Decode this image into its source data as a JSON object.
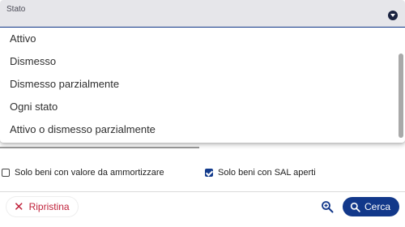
{
  "select": {
    "label": "Stato",
    "caret_icon": "chevron-down-circle-icon"
  },
  "menu": {
    "items": [
      {
        "label": "Attivo"
      },
      {
        "label": "Dismesso"
      },
      {
        "label": "Dismesso parzialmente"
      },
      {
        "label": "Ogni stato"
      },
      {
        "label": "Attivo o dismesso parzialmente"
      }
    ]
  },
  "filters": {
    "ammortizzare_label": "Solo beni con valore da ammortizzare",
    "ammortizzare_checked": false,
    "sal_label": "Solo beni con SAL aperti",
    "sal_checked": true
  },
  "actions": {
    "reset_label": "Ripristina",
    "reset_icon": "close-icon",
    "zoom_icon": "zoom-in-icon",
    "search_label": "Cerca",
    "search_icon": "search-icon"
  },
  "colors": {
    "primary": "#12388a",
    "danger": "#c0213a",
    "field_bg": "#e6e6ea"
  }
}
